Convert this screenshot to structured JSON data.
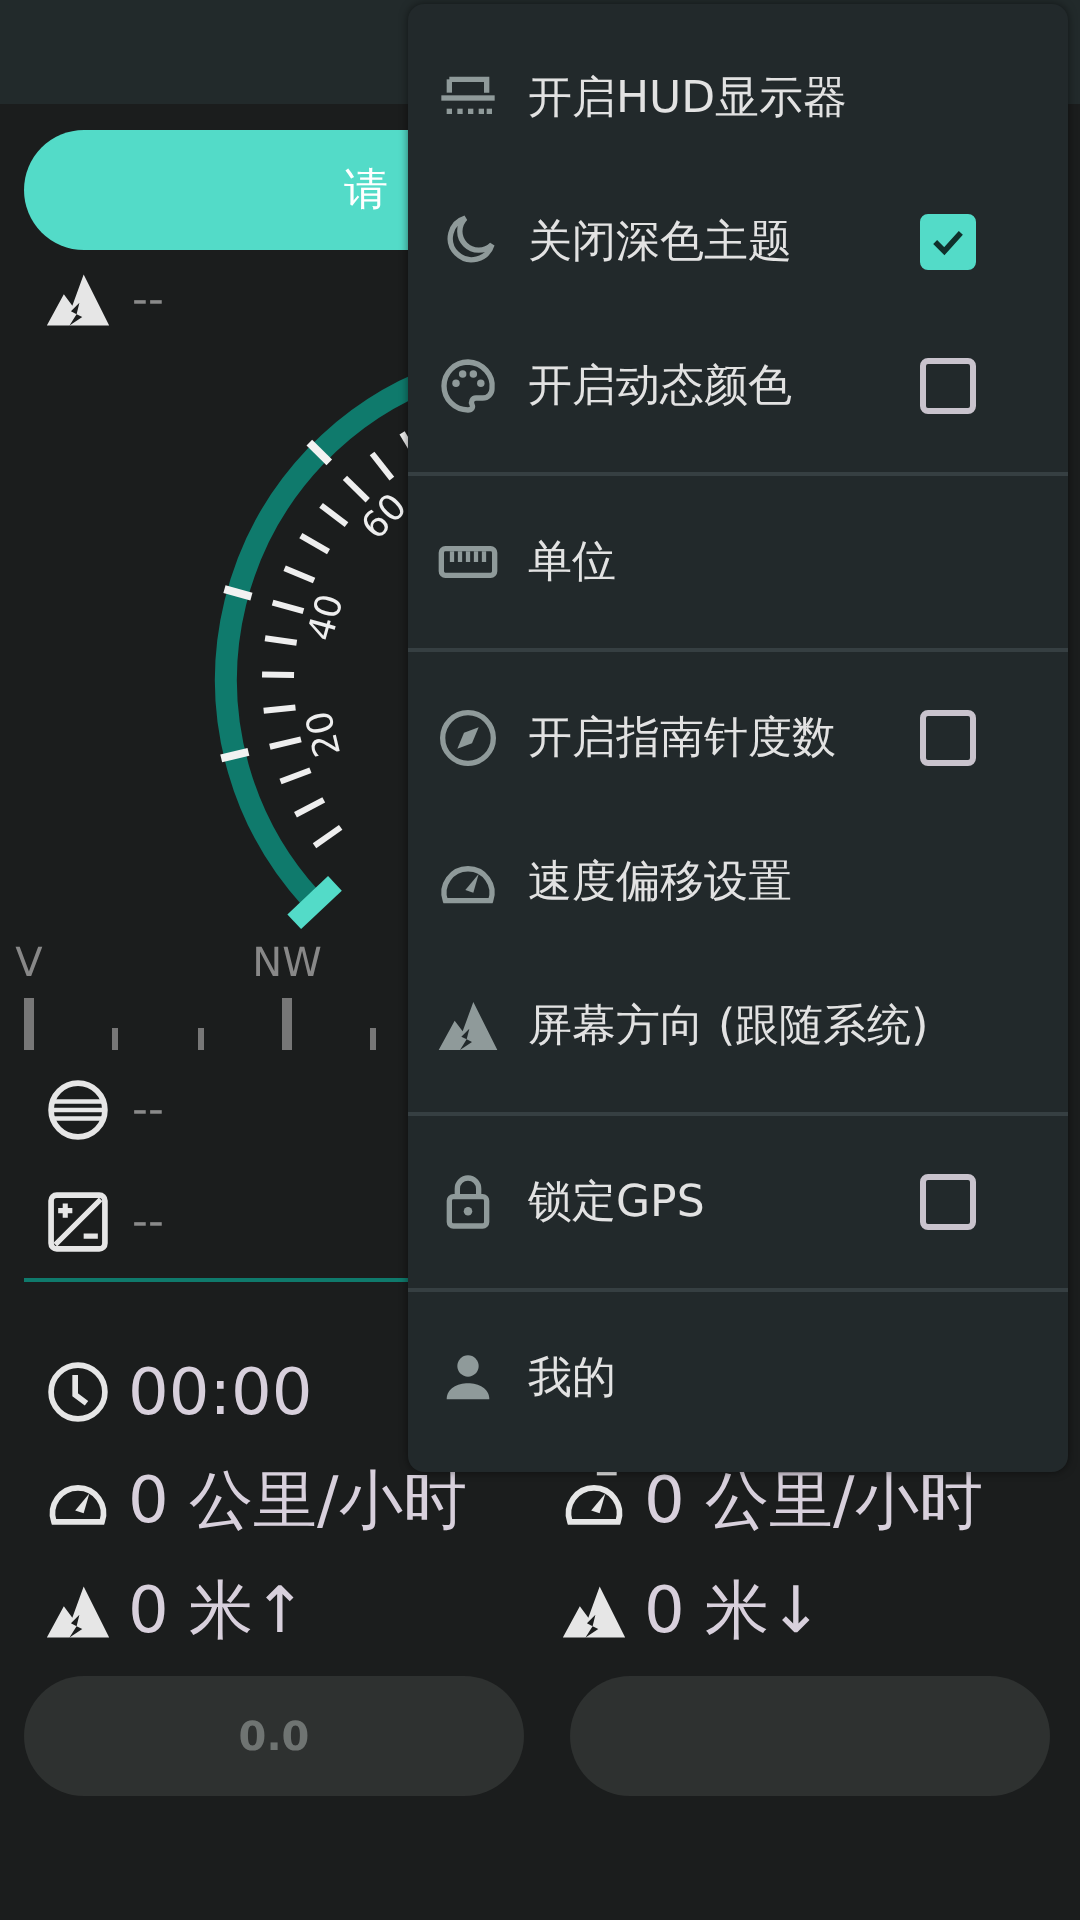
{
  "start_button": {
    "label": "请"
  },
  "altitude": {
    "value": "--"
  },
  "gauge": {
    "labels": [
      "20",
      "40",
      "60"
    ]
  },
  "compass": {
    "marks": [
      {
        "kind": "major",
        "label": "V"
      },
      {
        "kind": "minor"
      },
      {
        "kind": "minor"
      },
      {
        "kind": "major",
        "label": "NW"
      },
      {
        "kind": "minor"
      }
    ]
  },
  "readings": [
    {
      "value": "--"
    },
    {
      "value": "--"
    }
  ],
  "stats": [
    [
      {
        "value": "00:00"
      }
    ],
    [
      {
        "value": "0 公里/小时"
      },
      {
        "value": "0 公里/小时"
      }
    ],
    [
      {
        "value": "0 米↑"
      },
      {
        "value": "0 米↓"
      }
    ]
  ],
  "bottom_buttons": [
    {
      "label": "0.0"
    }
  ],
  "menu": {
    "groups": [
      [
        {
          "kind": "plain",
          "label": "开启HUD显示器"
        },
        {
          "kind": "check",
          "label": "关闭深色主题",
          "checked": true
        },
        {
          "kind": "check",
          "label": "开启动态颜色",
          "checked": false
        }
      ],
      [
        {
          "kind": "plain",
          "label": "单位"
        }
      ],
      [
        {
          "kind": "check",
          "label": "开启指南针度数",
          "checked": false
        },
        {
          "kind": "plain",
          "label": "速度偏移设置"
        },
        {
          "kind": "plain",
          "label": "屏幕方向 (跟随系统)"
        }
      ],
      [
        {
          "kind": "check",
          "label": "锁定GPS",
          "checked": false
        }
      ],
      [
        {
          "kind": "plain",
          "label": "我的"
        }
      ]
    ]
  }
}
